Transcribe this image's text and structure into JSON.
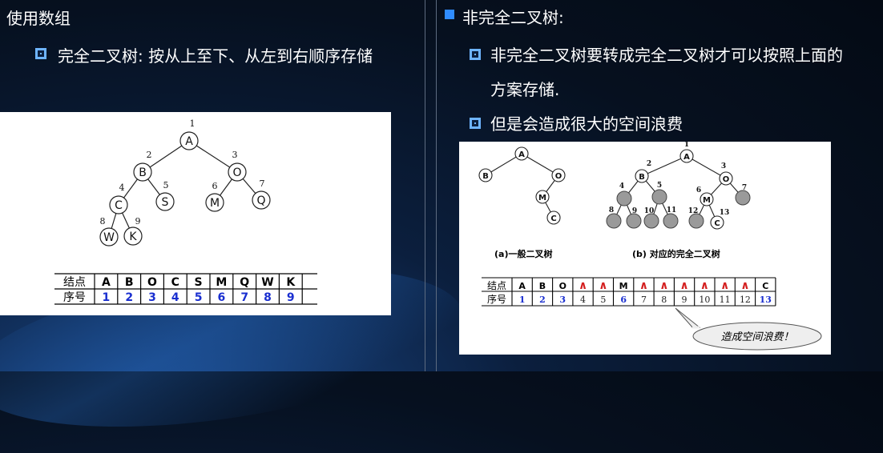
{
  "left": {
    "heading": "使用数组",
    "bullet": "完全二叉树: 按从上至下、从左到右顺序存储",
    "tree_nodes": [
      {
        "label": "A",
        "index": "1"
      },
      {
        "label": "B",
        "index": "2"
      },
      {
        "label": "O",
        "index": "3"
      },
      {
        "label": "C",
        "index": "4"
      },
      {
        "label": "S",
        "index": "5"
      },
      {
        "label": "M",
        "index": "6"
      },
      {
        "label": "Q",
        "index": "7"
      },
      {
        "label": "W",
        "index": "8"
      },
      {
        "label": "K",
        "index": "9"
      }
    ],
    "table": {
      "row1_header": "结点",
      "row2_header": "序号",
      "nodes": [
        "A",
        "B",
        "O",
        "C",
        "S",
        "M",
        "Q",
        "W",
        "K"
      ],
      "indices": [
        "1",
        "2",
        "3",
        "4",
        "5",
        "6",
        "7",
        "8",
        "9"
      ]
    }
  },
  "right": {
    "heading": "非完全二叉树:",
    "bullet1_line1": "非完全二叉树要转成完全二叉树才可以按照上面的",
    "bullet1_line2": "方案存储.",
    "bullet2": "但是会造成很大的空间浪费",
    "tree_a_nodes": [
      "A",
      "B",
      "O",
      "M",
      "C"
    ],
    "tree_b_nodes": [
      "A",
      "B",
      "O",
      "M",
      "C"
    ],
    "tree_b_indices": [
      "1",
      "2",
      "3",
      "4",
      "5",
      "6",
      "7",
      "8",
      "9",
      "10",
      "11",
      "12",
      "13"
    ],
    "caption_a": "(a)一般二叉树",
    "caption_b": "(b) 对应的完全二叉树",
    "table": {
      "row1_header": "结点",
      "row2_header": "序号",
      "nodes": [
        "A",
        "B",
        "O",
        "∧",
        "∧",
        "M",
        "∧",
        "∧",
        "∧",
        "∧",
        "∧",
        "∧",
        "C"
      ],
      "indices": [
        "1",
        "2",
        "3",
        "4",
        "5",
        "6",
        "7",
        "8",
        "9",
        "10",
        "11",
        "12",
        "13"
      ]
    },
    "callout": "造成空间浪费！"
  },
  "colors": {
    "accent_blue": "#2f8cff",
    "index_blue": "#1a2fd0",
    "lambda_red": "#d42020",
    "ghost_node": "#9a9a9a"
  }
}
